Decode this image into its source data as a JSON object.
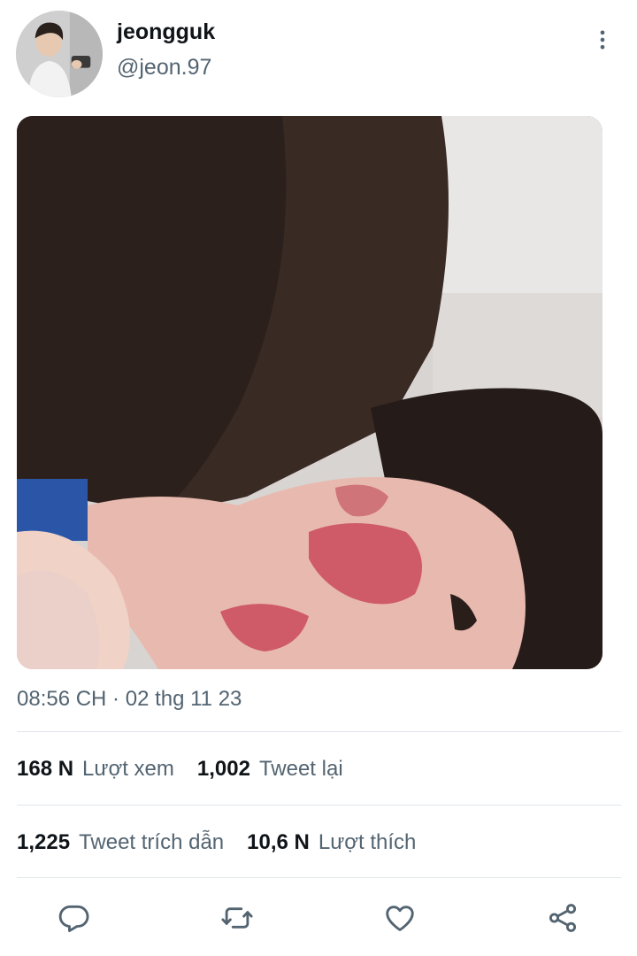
{
  "user": {
    "display_name": "jeongguk",
    "handle": "@jeon.97",
    "avatar_icon": "profile-photo"
  },
  "post": {
    "timestamp": "08:56 CH · 02 thg 11 23"
  },
  "stats": {
    "views_count": "168 N",
    "views_label": "Lượt xem",
    "retweets_count": "1,002",
    "retweets_label": "Tweet lại",
    "quotes_count": "1,225",
    "quotes_label": "Tweet trích dẫn",
    "likes_count": "10,6 N",
    "likes_label": "Lượt thích"
  },
  "actions": [
    {
      "icon": "reply-icon"
    },
    {
      "icon": "retweet-icon"
    },
    {
      "icon": "heart-icon"
    },
    {
      "icon": "share-icon"
    }
  ],
  "colors": {
    "text_primary": "#0f1419",
    "text_secondary": "#536471",
    "divider": "#e1e6ea",
    "icon": "#536471"
  }
}
